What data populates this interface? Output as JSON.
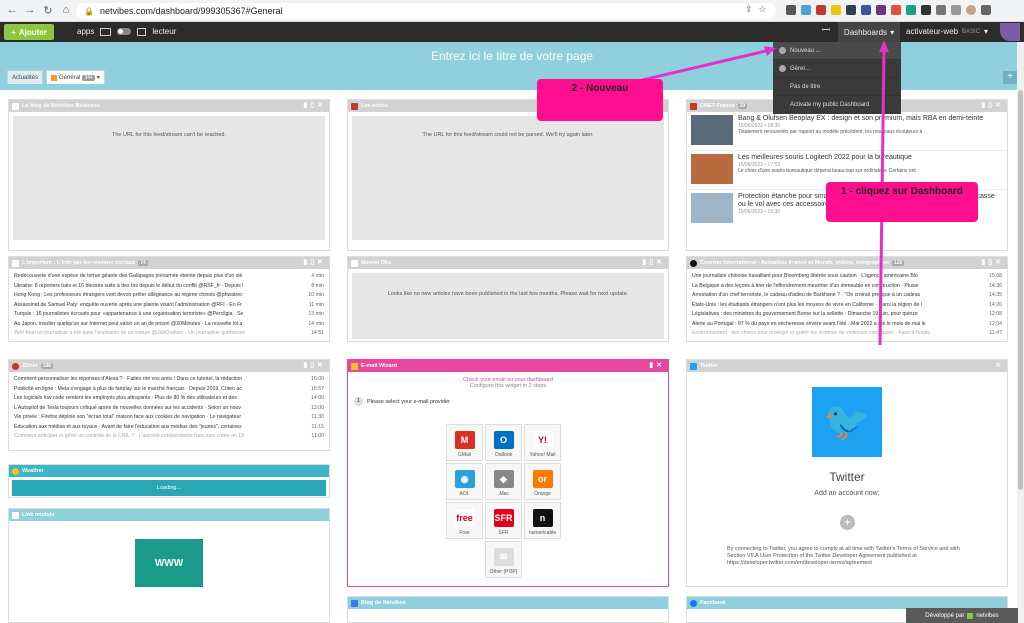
{
  "browser": {
    "url": "netvibes.com/dashboard/999305367#General"
  },
  "appbar": {
    "add_label": "Ajouter",
    "apps_label": "apps",
    "reader_label": "lecteur",
    "dashboards_label": "Dashboards",
    "user_label": "activateur-web",
    "plan_label": "BASIC"
  },
  "header": {
    "page_title": "Entrez ici le titre de votre page",
    "tabs": [
      {
        "label": "Actualités"
      },
      {
        "label": "Général",
        "count": "344"
      }
    ]
  },
  "dropdown": {
    "items": [
      "Nouveau ...",
      "Gérer...",
      "Pas de titre",
      "Activate my public Dashboard"
    ]
  },
  "annotations": {
    "callout_1": "1 - cliquez sur Dashboard",
    "callout_2": "2 - Nouveau"
  },
  "widgets": {
    "netvibes_business": {
      "title": "Le blog de Netvibes Business",
      "message": "The URL for this feed/stream can't be reached."
    },
    "les_echos": {
      "title": "Les echos",
      "message": "The URL for this feed/stream could not be parsed. We'll try again later."
    },
    "cnet": {
      "title": "CNET France",
      "count": "20",
      "articles": [
        {
          "title": "Bang & Olufsen Beoplay EX : design et son premium, mais RBA en demi-teinte",
          "date": "15/06/2022 • 18:30",
          "excerpt": "Totalement renouvelés par rapport au modèle précédent, les nouveaux écouteurs à"
        },
        {
          "title": "Les meilleures souris Logitech 2022 pour la bureautique",
          "date": "15/06/2022 • 17:53",
          "excerpt": "Le choix d'une souris bureautique dépend beaucoup sur ordinateur. Certains ont"
        },
        {
          "title": "Protection étanche pour smartphone : faites en sorte que votre téléphone ne casse ou le vol avec ces accessoires",
          "date": "15/06/2022 • 15:30",
          "excerpt": ""
        }
      ]
    },
    "important": {
      "title": "L'important : L'info par les réseaux sociaux",
      "count": "74",
      "items": [
        {
          "text": "Redécouverte d'une espèce de tortue géante des Galápagos présumée éteinte depuis plus d'un siè",
          "time": "4 min"
        },
        {
          "text": "Ukraine: 8 reporters tués et 16 blessés suite à des tirs depuis le début du conflit @RSF_fr · Depuis l",
          "time": "8 min"
        },
        {
          "text": "Hong Kong : Les professeurs étrangers vont devoir prêter allégeance au régime chinois @phwatrec",
          "time": "10 min"
        },
        {
          "text": "Assassinat de Samuel Paty: enquête ouverte après une plainte visant l'administration @RFI · En Fr",
          "time": "11 min"
        },
        {
          "text": "Turquie : 16 journalistes écroués pour «appartenance à une organisation terroriste» @Percilgia · Se",
          "time": "13 min"
        },
        {
          "text": "Au Japon, insulter quelqu'un sur Internet peut valoir un an de prison @20Minutes · La nouvelle loi a",
          "time": "14 min"
        },
        {
          "text": "Yeh! Mon un journaliste a été dans l'explosion de sa voiture @JdeQuébec · Un journaliste québécois",
          "time": "14:51"
        }
      ]
    },
    "nouvel_obs": {
      "title": "Nouvel Obs",
      "message": "Looks like no new articles have been published in the last few months. Please wait for next update."
    },
    "courrier": {
      "title": "Courrier International - Actualités France et Monde, vidéos, infographies",
      "count": "120",
      "items": [
        {
          "text": "Une journaliste chinoise travaillant pour Bloomberg libérée sous caution · L'agence américaine Blo",
          "time": "15:08"
        },
        {
          "text": "La Belgique a des leçons à tirer de l'effondrement meurtrier d'un immeuble en construction · Plusie",
          "time": "14:36"
        },
        {
          "text": "Arrestation d'un chef terroriste, le cadeau d'adieu de Barkhane ? · \"On croirait presque à un cadeau",
          "time": "14:35"
        },
        {
          "text": "États-Unis : les étudiants étrangers n'ont plus les moyens de vivre en Californie · Dans la région de l",
          "time": "14:26"
        },
        {
          "text": "Législatives : des ministres du gouvernement Borne sur la sellette · Dimanche 19 juin, pour quinze",
          "time": "12:08"
        },
        {
          "text": "Alerte au Portugal : 97 % du pays en sécheresse sévère avant l'été · Mai 2022 a été le mois de mai le",
          "time": "12:04"
        },
        {
          "text": "Environnement : des chiens pour protéger et guérir les victimes de violences conjugales · Face à l'explo",
          "time": "11:47"
        }
      ]
    },
    "zdnet": {
      "title": "ZDnet",
      "count": "198",
      "items": [
        {
          "text": "Comment personnaliser les réponses d'Alexa ? · Faites rire vos amis ! Dans ce tutoriel, la rédaction",
          "time": "16:00"
        },
        {
          "text": "Publicité en ligne : Meta s'engage à plus de fairplay sur le marché français · Depuis 2019, Criteo ac",
          "time": "15:57"
        },
        {
          "text": "Les logiciels low code rendent les employés plus attrayants · Plus de 80 % des utilisateurs et des",
          "time": "14:00"
        },
        {
          "text": "L'Autopilot de Tesla toujours critiqué après de nouvelles données sur les accidents · Selon un nouv",
          "time": "13:00"
        },
        {
          "text": "Vie privée : Firefox déploie son \"écran total\" maison face aux cookies de navigation · Le navigateur",
          "time": "11:30"
        },
        {
          "text": "Éducation aux médias et aux tuyaux · Avant de faire l'éducation aux médias des \"jeunes\", certaines",
          "time": "11:15"
        },
        {
          "text": "Comment anticiper et gérer un contrôle de la CNIL ? · L'autorité indépendante française créée en 19",
          "time": "11:00"
        }
      ]
    },
    "email_wizard": {
      "title": "E-mail Wizard",
      "heading": "Check your email on your dashboard",
      "subheading": "Configure this widget in 2 steps",
      "step_number": "1",
      "step_label": "Please select your e-mail provider",
      "providers": [
        {
          "label": "GMail",
          "color": "#d93025",
          "glyph": "M"
        },
        {
          "label": "Outlook",
          "color": "#0072c6",
          "glyph": "O"
        },
        {
          "label": "Yahoo! Mail",
          "color": "#ffffff",
          "glyph": "Y!"
        },
        {
          "label": "AOL",
          "color": "#2ba0e0",
          "glyph": "◉"
        },
        {
          "label": ".Mac",
          "color": "#888888",
          "glyph": "◆"
        },
        {
          "label": "Orange",
          "color": "#ff7900",
          "glyph": "or"
        },
        {
          "label": "Free",
          "color": "#ffffff",
          "glyph": "free"
        },
        {
          "label": "SFR",
          "color": "#e2001a",
          "glyph": "SFR"
        },
        {
          "label": "numericable",
          "color": "#111111",
          "glyph": "n"
        },
        {
          "label": "Other (POP)",
          "color": "#dddddd",
          "glyph": "✉"
        }
      ]
    },
    "twitter": {
      "title": "Twitter",
      "name": "Twitter",
      "add_account": "Add an account now:",
      "terms": "By connecting to Twitter, you agree to comply at all time with Twitter's Terms of Service and with Section VII.A User Protection of the Twitter Developer Agreement published at https://developer.twitter.com/en/developer-terms/agreement"
    },
    "weather": {
      "title": "Weather",
      "loading": "Loading..."
    },
    "link_module": {
      "title": "Link module",
      "logo_text": "WWW"
    },
    "blog_netvibes": {
      "title": "Blog de Netvibes"
    },
    "facebook": {
      "title": "Facebook"
    }
  },
  "footer": {
    "label": "Développé par",
    "brand": "netvibes"
  }
}
